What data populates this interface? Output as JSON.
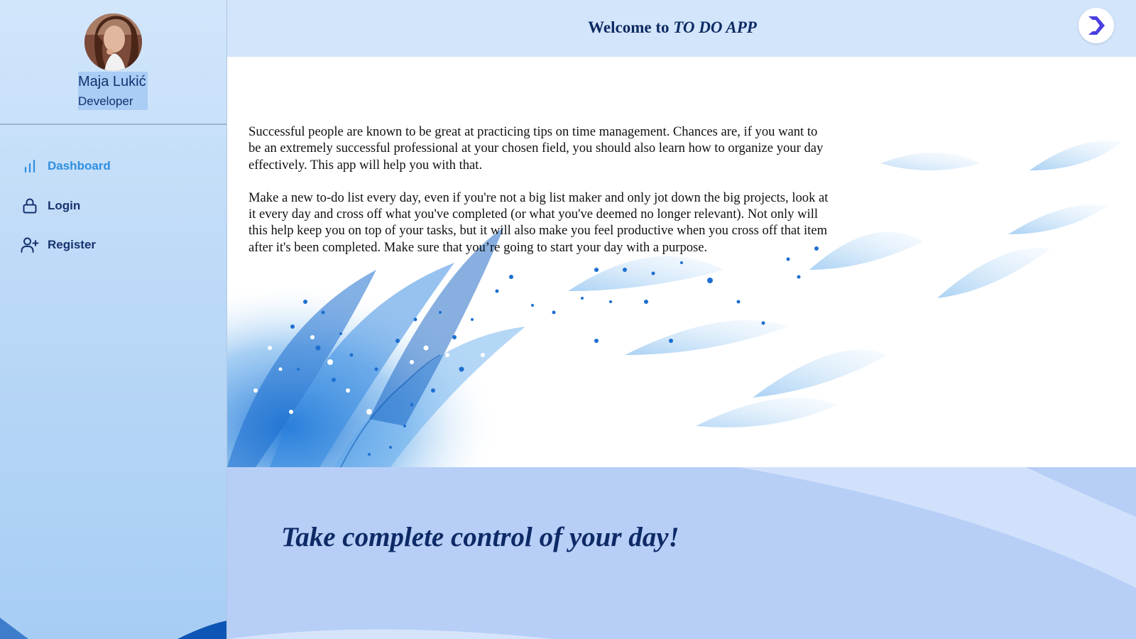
{
  "user": {
    "name": "Maja Lukić",
    "role": "Developer"
  },
  "nav": {
    "items": [
      {
        "label": "Dashboard",
        "icon": "bar-chart-icon",
        "active": true
      },
      {
        "label": "Login",
        "icon": "lock-icon",
        "active": false
      },
      {
        "label": "Register",
        "icon": "add-user-icon",
        "active": false
      }
    ]
  },
  "header": {
    "title_prefix": "Welcome to",
    "title_app": "TO DO APP",
    "logo_icon": "app-logo-icon"
  },
  "content": {
    "paragraph_1": "Successful people are known to be great at practicing tips on time management. Chances are, if you want to be an extremely successful professional at your chosen field, you should also learn how to organize your day effectively. This app will help you with that.",
    "paragraph_2": "Make a new to-do list every day, even if you're not a big list maker and only jot down the big projects, look at it every day and cross off what you've completed (or what you've deemed no longer relevant). Not only will this help keep you on top of your tasks, but it will also make you feel productive when you cross off that item after it's been completed. Make sure that you’re going to start your day with a purpose."
  },
  "slogan": "Take complete control of your day!",
  "colors": {
    "accent": "#2f8fe0",
    "navy": "#0d2a63",
    "header_bg": "#d3e5fb",
    "band_bg": "#b7cff7"
  }
}
